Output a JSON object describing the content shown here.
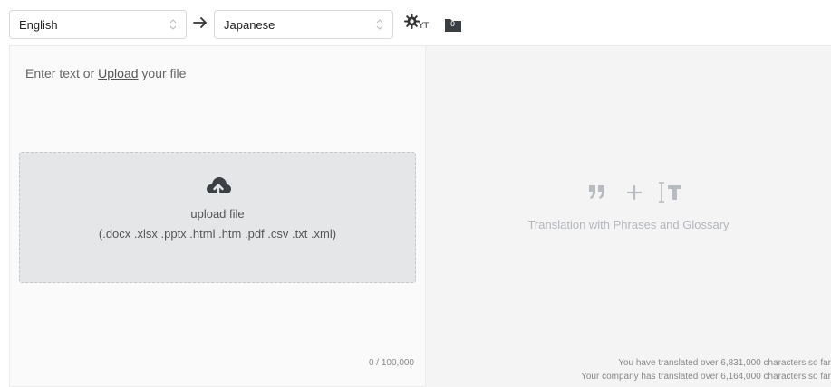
{
  "toolbar": {
    "source_language": "English",
    "target_language": "Japanese",
    "settings_suffix": "YT",
    "folder_count": "0"
  },
  "input": {
    "prompt_before": "Enter text or ",
    "upload_link": "Upload",
    "prompt_after": " your file",
    "char_counter": "0 / 100,000"
  },
  "dropzone": {
    "title": "upload file",
    "formats": "(.docx .xlsx .pptx .html .htm .pdf .csv .txt .xml)"
  },
  "output": {
    "feature_label": "Translation with Phrases and Glossary",
    "user_stat": "You have translated over 6,831,000 characters so far",
    "company_stat": "Your company has translated over 6,164,000 characters so far"
  }
}
